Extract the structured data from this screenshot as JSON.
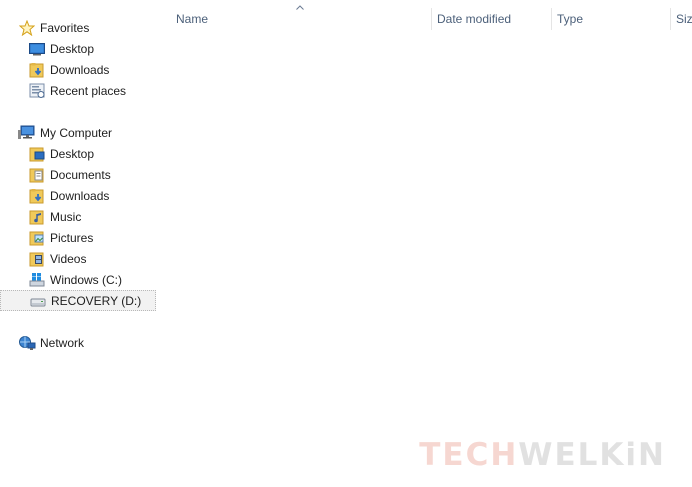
{
  "navigation": {
    "favorites": {
      "label": "Favorites",
      "items": [
        {
          "label": "Desktop"
        },
        {
          "label": "Downloads"
        },
        {
          "label": "Recent places"
        }
      ]
    },
    "computer": {
      "label": "My Computer",
      "items": [
        {
          "label": "Desktop"
        },
        {
          "label": "Documents"
        },
        {
          "label": "Downloads"
        },
        {
          "label": "Music"
        },
        {
          "label": "Pictures"
        },
        {
          "label": "Videos"
        },
        {
          "label": "Windows (C:)"
        },
        {
          "label": "RECOVERY (D:)",
          "selected": true
        }
      ]
    },
    "network": {
      "label": "Network"
    }
  },
  "columns": {
    "name": "Name",
    "date_modified": "Date modified",
    "type": "Type",
    "size": "Siz"
  },
  "watermark": {
    "part1": "TECH",
    "part2": "WELKiN"
  },
  "colors": {
    "header_text": "#4c607a",
    "selection_bg": "#f2f2f2",
    "watermark_red": "#f6d5cf",
    "watermark_gray": "#e0e0e0"
  }
}
